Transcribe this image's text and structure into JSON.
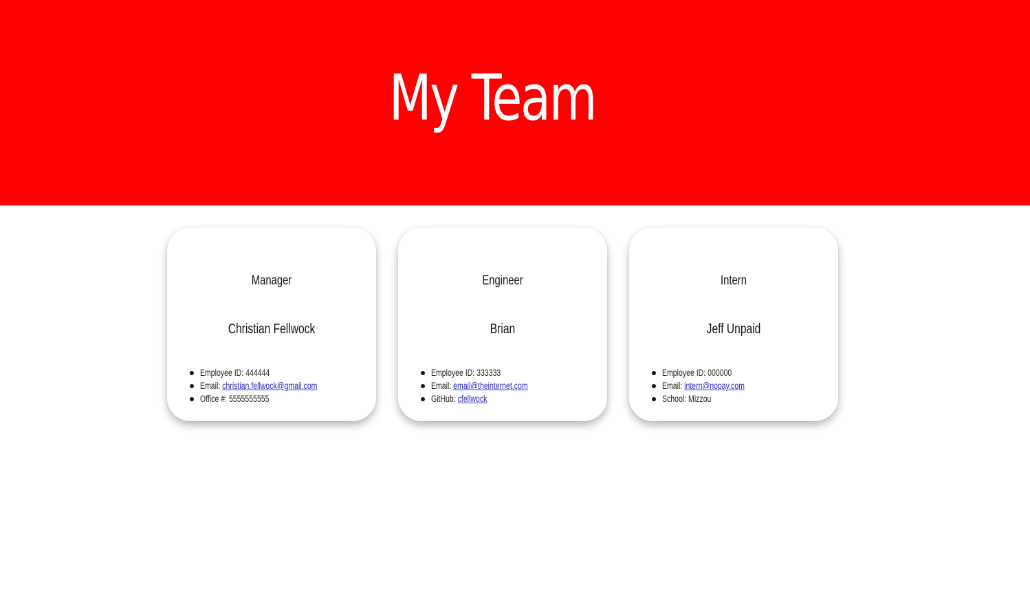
{
  "header": {
    "title": "My Team",
    "background_color": "#ff0000",
    "text_color": "#ffffff"
  },
  "cards": [
    {
      "role": "Manager",
      "name": "Christian Fellwock",
      "details": [
        {
          "label": "Employee ID: ",
          "value": "444444"
        },
        {
          "label": "Email: ",
          "link": "christian.fellwock@gmail.com"
        },
        {
          "label": "Office #: ",
          "value": "5555555555"
        }
      ]
    },
    {
      "role": "Engineer",
      "name": "Brian",
      "details": [
        {
          "label": "Employee ID: ",
          "value": "333333"
        },
        {
          "label": "Email: ",
          "link": "email@theinternet.com"
        },
        {
          "label": "GitHub: ",
          "link": "cfellwock"
        }
      ]
    },
    {
      "role": "Intern",
      "name": "Jeff Unpaid",
      "details": [
        {
          "label": "Employee ID: ",
          "value": "000000"
        },
        {
          "label": "Email: ",
          "link": "intern@nopay.com"
        },
        {
          "label": "School: ",
          "value": "Mizzou"
        }
      ]
    }
  ],
  "colors": {
    "link": "#2a2ab8"
  }
}
